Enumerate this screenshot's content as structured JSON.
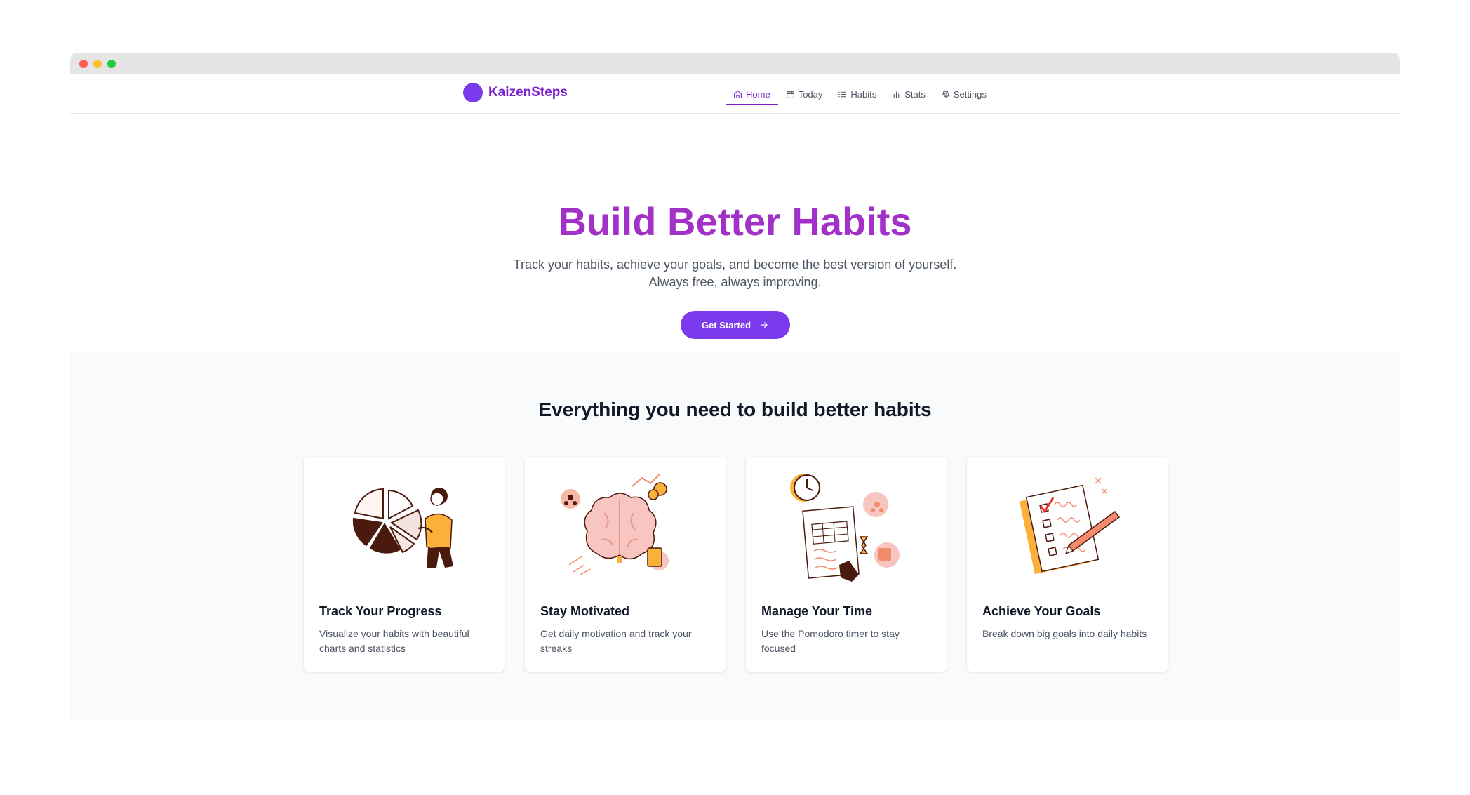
{
  "window": {
    "controls": [
      "close",
      "minimize",
      "maximize"
    ]
  },
  "navbar": {
    "brand": "KaizenSteps",
    "items": [
      {
        "label": "Home",
        "icon": "home-icon",
        "active": true
      },
      {
        "label": "Today",
        "icon": "calendar-icon",
        "active": false
      },
      {
        "label": "Habits",
        "icon": "list-icon",
        "active": false
      },
      {
        "label": "Stats",
        "icon": "bar-chart-icon",
        "active": false
      },
      {
        "label": "Settings",
        "icon": "gear-icon",
        "active": false
      }
    ]
  },
  "hero": {
    "title": "Build Better Habits",
    "subtitle_line1": "Track your habits, achieve your goals, and become the best version of yourself.",
    "subtitle_line2": "Always free, always improving.",
    "cta_label": "Get Started"
  },
  "features": {
    "title": "Everything you need to build better habits",
    "cards": [
      {
        "title": "Track Your Progress",
        "description": "Visualize your habits with beautiful charts and statistics",
        "illustration": "pie-chart-person-illustration"
      },
      {
        "title": "Stay Motivated",
        "description": "Get daily motivation and track your streaks",
        "illustration": "brain-illustration"
      },
      {
        "title": "Manage Your Time",
        "description": "Use the Pomodoro timer to stay focused",
        "illustration": "clock-schedule-illustration"
      },
      {
        "title": "Achieve Your Goals",
        "description": "Break down big goals into daily habits",
        "illustration": "checklist-pencil-illustration"
      }
    ]
  },
  "colors": {
    "brand": "#7c3aed",
    "brand_text": "#7e22ce",
    "accent_illustration": "#f28b6b",
    "illustration_dark": "#4a1a0e",
    "illustration_yellow": "#fbb03b"
  }
}
